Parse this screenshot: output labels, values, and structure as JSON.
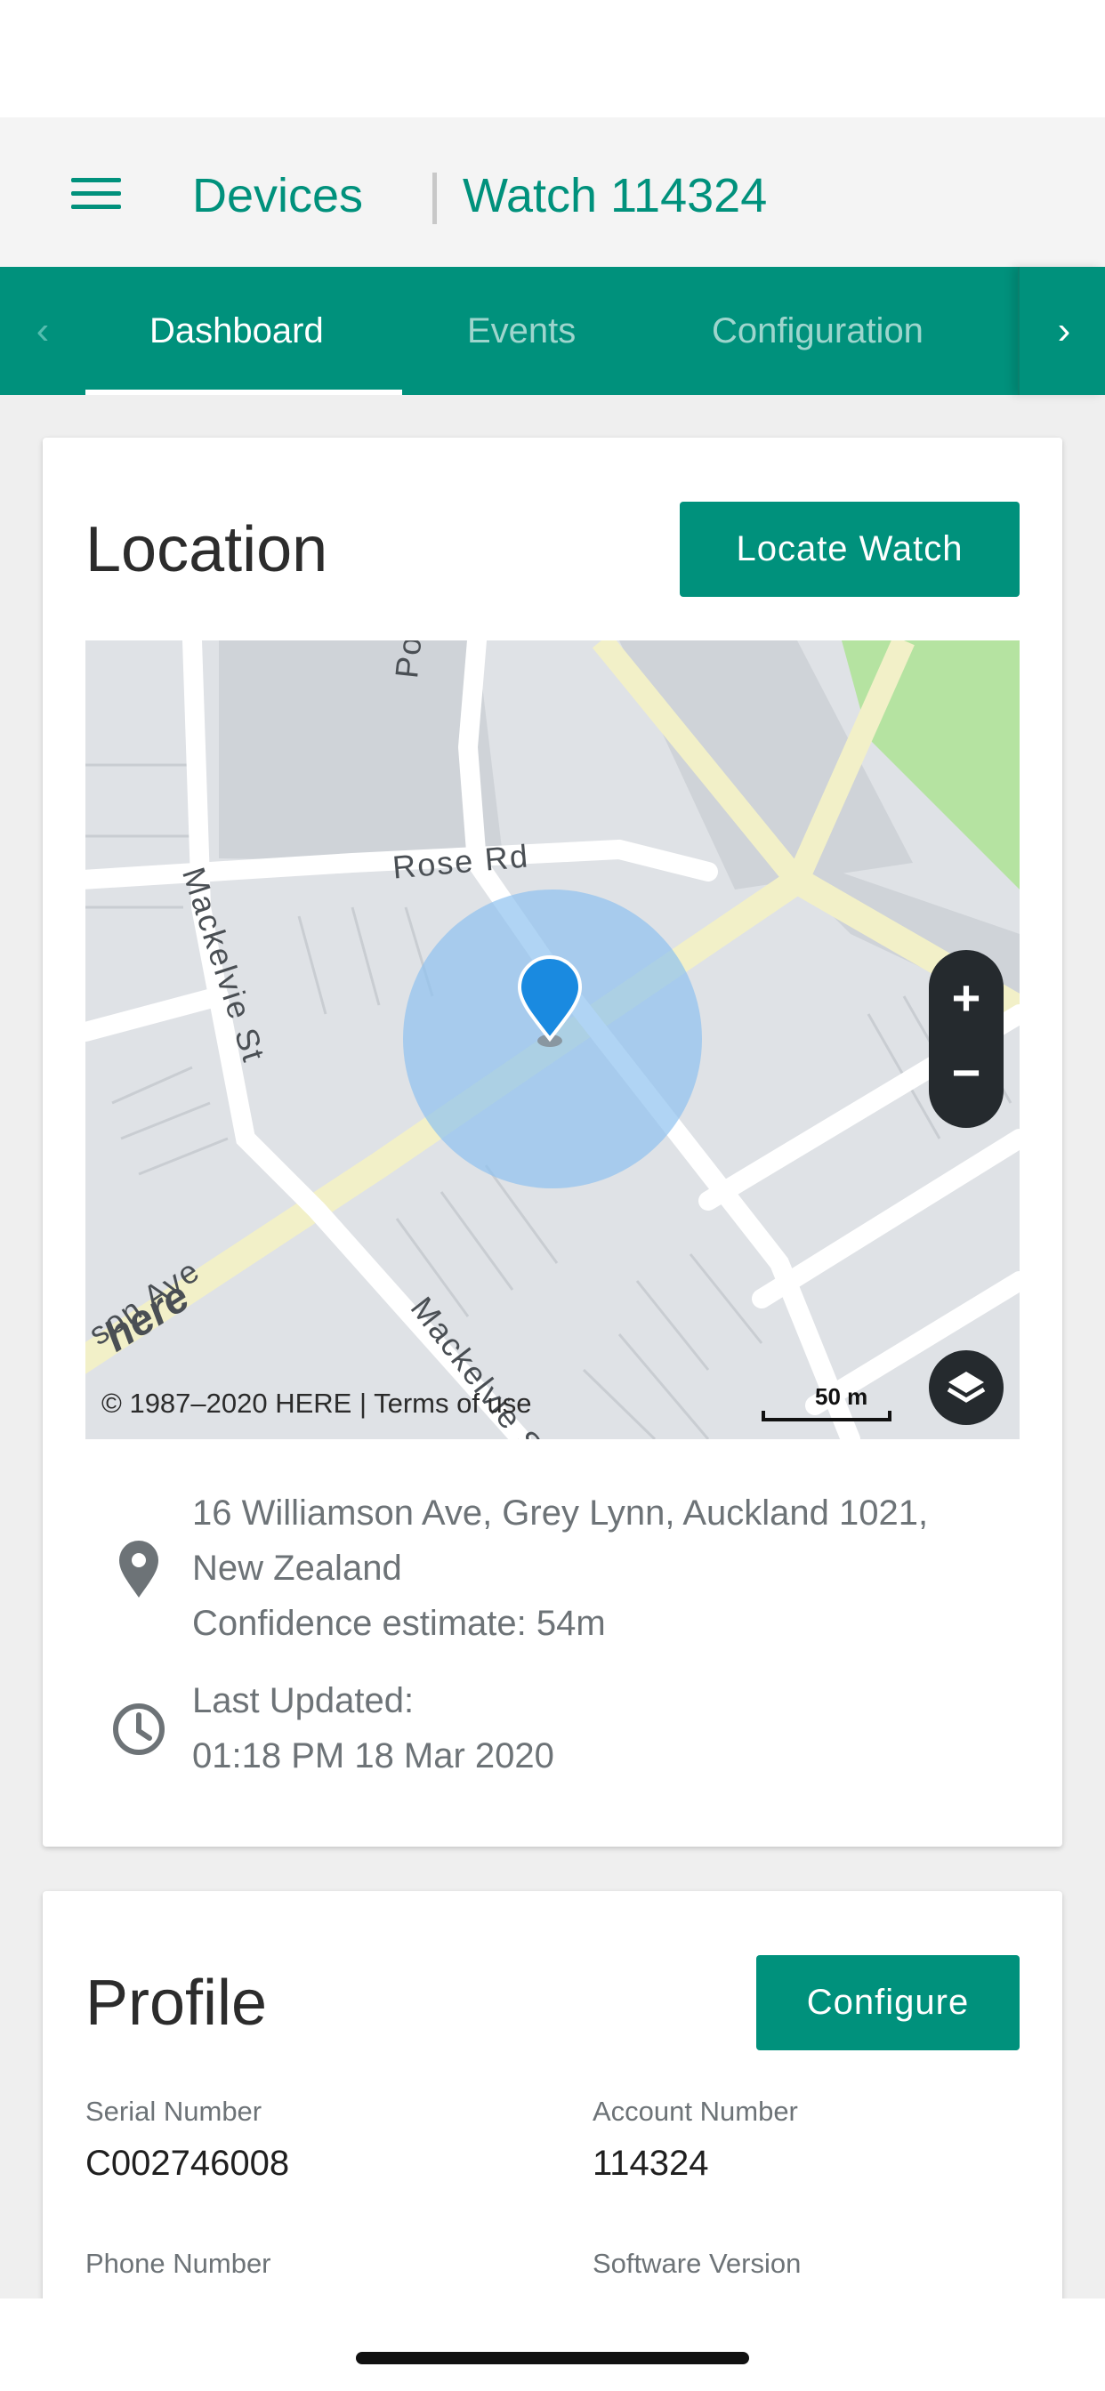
{
  "header": {
    "menu_icon": "hamburger-menu-icon",
    "breadcrumb_root": "Devices",
    "breadcrumb_current": "Watch 114324"
  },
  "tabs": {
    "items": [
      {
        "label": "Dashboard",
        "active": true
      },
      {
        "label": "Events",
        "active": false
      },
      {
        "label": "Configuration",
        "active": false
      }
    ],
    "prev_icon": "chevron-left-icon",
    "next_icon": "chevron-right-icon"
  },
  "location": {
    "title": "Location",
    "locate_button": "Locate Watch",
    "map": {
      "streets": [
        "Pollen St",
        "Rose Rd",
        "Mackelvie St",
        "Mackelvie St",
        "son Ave"
      ],
      "copyright": "© 1987–2020 HERE | Terms of use",
      "scale": "50 m",
      "zoom_in": "+",
      "zoom_out": "−",
      "logo": "here",
      "accuracy_circle_color": "#8fc2ef",
      "pin_color": "#1a8ae0"
    },
    "address_line1": "16 Williamson Ave, Grey Lynn, Auckland 1021,",
    "address_line2": "New Zealand",
    "confidence": "Confidence estimate: 54m",
    "last_updated_label": "Last Updated:",
    "last_updated_value": "01:18 PM 18 Mar 2020",
    "address_icon": "map-pin-icon",
    "time_icon": "clock-icon"
  },
  "profile": {
    "title": "Profile",
    "configure_button": "Configure",
    "fields": [
      {
        "label": "Serial Number",
        "value": "C002746008"
      },
      {
        "label": "Account Number",
        "value": "114324"
      },
      {
        "label": "Phone Number",
        "value": ""
      },
      {
        "label": "Software Version",
        "value": ""
      }
    ]
  },
  "colors": {
    "brand": "#00917c",
    "background": "#efefef"
  }
}
